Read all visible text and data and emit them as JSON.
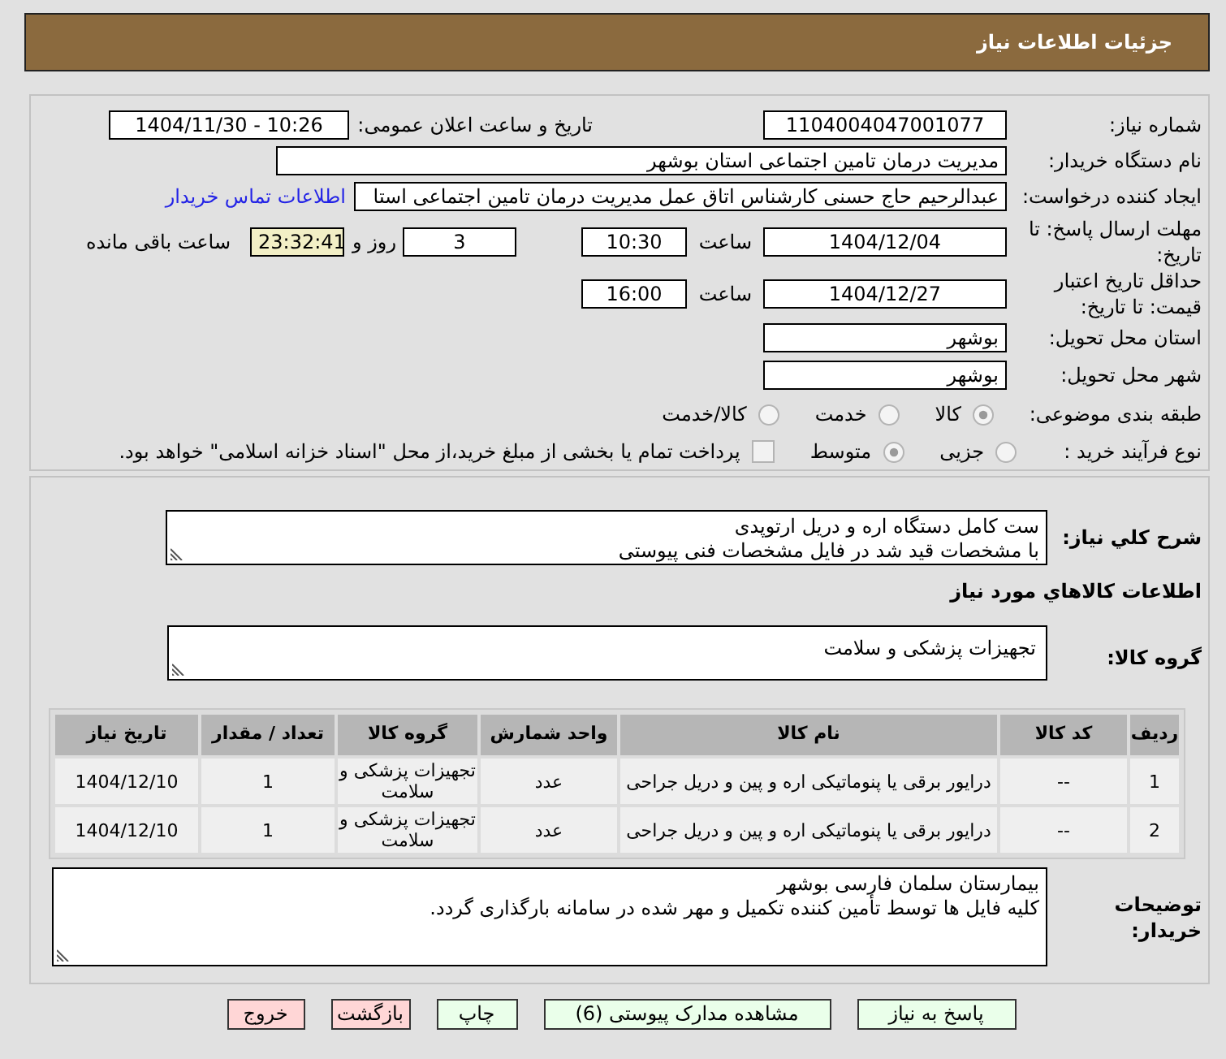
{
  "header": {
    "title": "جزئیات اطلاعات نیاز"
  },
  "details": {
    "need_number": {
      "label": "شماره نیاز:",
      "value": "1104004047001077"
    },
    "announce": {
      "label": "تاریخ و ساعت اعلان عمومی:",
      "value": "1404/11/30 - 10:26"
    },
    "buyer": {
      "label": "نام دستگاه خریدار:",
      "value": "مدیریت درمان تامین اجتماعی استان بوشهر"
    },
    "creator": {
      "label": "ایجاد کننده درخواست:",
      "value": "عبدالرحیم حاج حسنی کارشناس اتاق عمل مدیریت درمان تامین اجتماعی استا",
      "link": "اطلاعات تماس خریدار"
    },
    "deadline": {
      "label": "مهلت ارسال پاسخ: تا تاریخ:",
      "date": "1404/12/04",
      "time_label": "ساعت",
      "time": "10:30",
      "days": "3",
      "days_label": "روز و",
      "remaining": "23:32:41",
      "remaining_label": "ساعت باقی مانده"
    },
    "validity": {
      "label": "حداقل تاریخ اعتبار قیمت: تا تاریخ:",
      "date": "1404/12/27",
      "time_label": "ساعت",
      "time": "16:00"
    },
    "province": {
      "label": "استان محل تحویل:",
      "value": "بوشهر"
    },
    "city": {
      "label": "شهر محل تحویل:",
      "value": "بوشهر"
    },
    "category": {
      "label": "طبقه بندی موضوعی:",
      "options": [
        {
          "label": "کالا",
          "selected": true
        },
        {
          "label": "خدمت",
          "selected": false
        },
        {
          "label": "کالا/خدمت",
          "selected": false
        }
      ]
    },
    "process": {
      "label": "نوع فرآیند خرید :",
      "options": [
        {
          "label": "جزیی",
          "selected": false
        },
        {
          "label": "متوسط",
          "selected": true
        }
      ],
      "treasury": {
        "label": "پرداخت تمام یا بخشی از مبلغ خرید،از محل \"اسناد خزانه اسلامی\" خواهد بود.",
        "checked": false
      }
    }
  },
  "need": {
    "description": {
      "label": "شرح کلي نياز:",
      "value": "ست کامل دستگاه اره و دریل ارتوپدی\nبا مشخصات قید شد در فایل مشخصات فنی پیوستی"
    },
    "goods_title": "اطلاعات کالاهاي مورد نياز",
    "group": {
      "label": "گروه کالا:",
      "value": "تجهیزات پزشکی و سلامت"
    },
    "table": {
      "columns": [
        "ردیف",
        "کد کالا",
        "نام کالا",
        "واحد شمارش",
        "گروه کالا",
        "تعداد / مقدار",
        "تاریخ نیاز"
      ],
      "rows": [
        [
          "1",
          "--",
          "درایور برقی یا پنوماتیکی اره و پین و دریل جراحی",
          "عدد",
          "تجهیزات پزشکی و سلامت",
          "1",
          "1404/12/10"
        ],
        [
          "2",
          "--",
          "درایور برقی یا پنوماتیکی اره و پین و دریل جراحی",
          "عدد",
          "تجهیزات پزشکی و سلامت",
          "1",
          "1404/12/10"
        ]
      ]
    },
    "notes": {
      "label": "توضیحات خریدار:",
      "value": "بیمارستان سلمان فارسی بوشهر\nکلیه فایل ها توسط تأمین کننده تکمیل و مهر شده در سامانه بارگذاری گردد."
    }
  },
  "buttons": [
    {
      "kind": "reply",
      "label": "پاسخ به نیاز"
    },
    {
      "kind": "attachments",
      "label": "مشاهده مدارک پیوستی (6)"
    },
    {
      "kind": "print",
      "label": "چاپ"
    },
    {
      "kind": "back",
      "label": "بازگشت"
    },
    {
      "kind": "exit",
      "label": "خروج"
    }
  ]
}
